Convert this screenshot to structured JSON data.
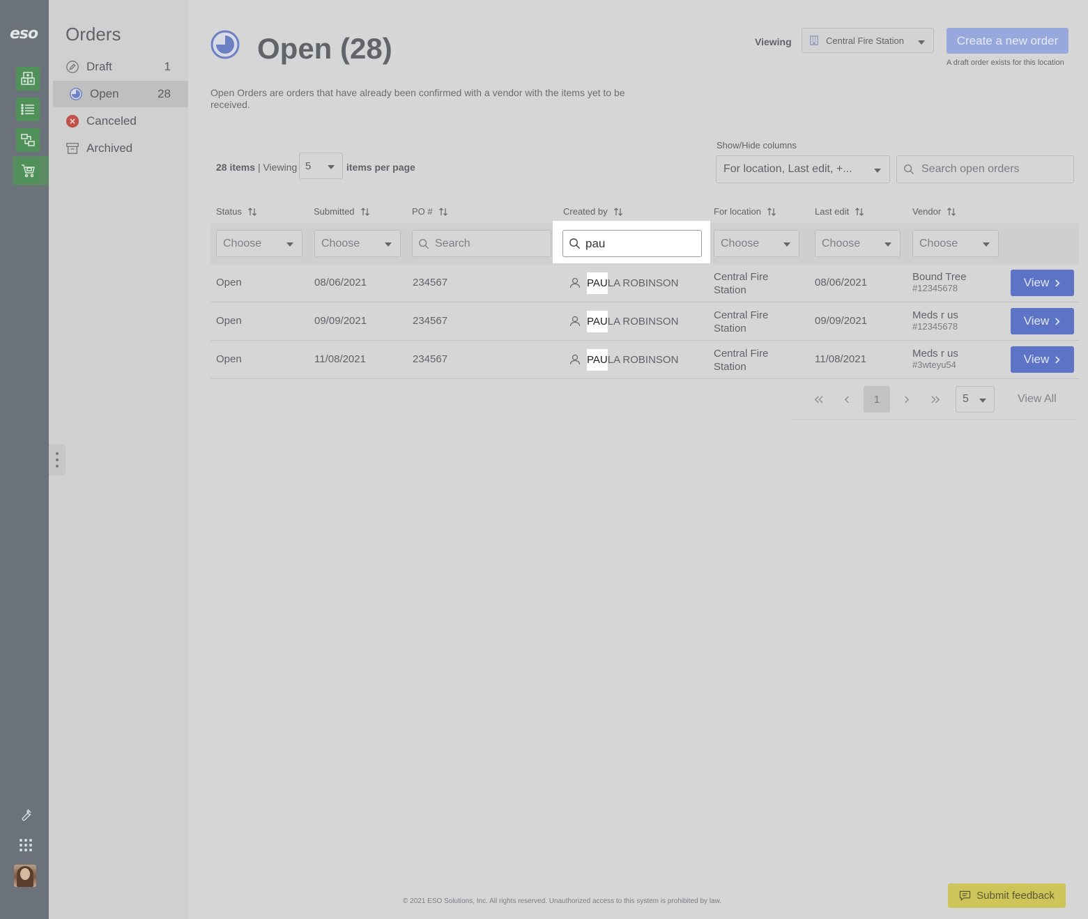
{
  "rail": {
    "logo": "eso",
    "icons": [
      "inventory-grid-icon",
      "list-icon",
      "transfer-icon",
      "cart-icon"
    ],
    "bottom_icons": [
      "wrench-icon",
      "app-grid-icon"
    ]
  },
  "sidebar": {
    "title": "Orders",
    "items": [
      {
        "label": "Draft",
        "count": "1",
        "icon": "pencil-circle-icon"
      },
      {
        "label": "Open",
        "count": "28",
        "icon": "pie-icon"
      },
      {
        "label": "Canceled",
        "count": "",
        "icon": "cancel-icon"
      },
      {
        "label": "Archived",
        "count": "",
        "icon": "archive-icon"
      }
    ]
  },
  "header": {
    "title": "Open (28)",
    "viewing_label": "Viewing",
    "location": "Central Fire Station",
    "create_button": "Create a new order",
    "draft_note": "A draft order exists for this location",
    "description": "Open Orders are orders that have already been confirmed with a vendor with the items yet to be received."
  },
  "toolbar": {
    "items_count": "28 items",
    "separator": "|",
    "viewing": "Viewing",
    "per_page_value": "5",
    "per_page_label": "items per page",
    "showhide_label": "Show/Hide columns",
    "showhide_value": "For location, Last edit, +...",
    "search_placeholder": "Search open orders"
  },
  "table": {
    "columns": [
      "Status",
      "Submitted",
      "PO #",
      "Created by",
      "For location",
      "Last edit",
      "Vendor"
    ],
    "filters": {
      "choose": "Choose",
      "po_placeholder": "Search",
      "created_by_value": "pau"
    },
    "rows": [
      {
        "status": "Open",
        "submitted": "08/06/2021",
        "po": "234567",
        "creator_match": "PAU",
        "creator_rest": "LA ROBINSON",
        "location_line1": "Central Fire",
        "location_line2": "Station",
        "last_edit": "08/06/2021",
        "vendor": "Bound Tree",
        "vendor_id": "#12345678",
        "action": "View"
      },
      {
        "status": "Open",
        "submitted": "09/09/2021",
        "po": "234567",
        "creator_match": "PAU",
        "creator_rest": "LA ROBINSON",
        "location_line1": "Central Fire",
        "location_line2": "Station",
        "last_edit": "09/09/2021",
        "vendor": "Meds r us",
        "vendor_id": "#12345678",
        "action": "View"
      },
      {
        "status": "Open",
        "submitted": "11/08/2021",
        "po": "234567",
        "creator_match": "PAU",
        "creator_rest": "LA ROBINSON",
        "location_line1": "Central Fire",
        "location_line2": "Station",
        "last_edit": "11/08/2021",
        "vendor": "Meds r us",
        "vendor_id": "#3wteyu54",
        "action": "View"
      }
    ]
  },
  "pagination": {
    "current_page": "1",
    "per_page": "5",
    "view_all": "View All"
  },
  "footer": {
    "copyright": "© 2021 ESO Solutions, Inc. All rights reserved. Unauthorized access to this system is prohibited by law.",
    "feedback": "Submit feedback"
  },
  "colors": {
    "accent": "#5d74c6",
    "rail": "#6b727a",
    "rail_button": "#4f9159",
    "feedback": "#cdc45a",
    "cancel": "#c0392b"
  }
}
